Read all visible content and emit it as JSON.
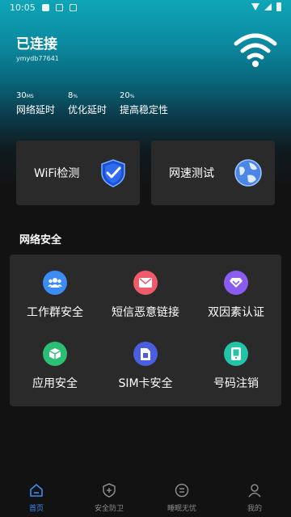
{
  "status_bar": {
    "time": "10:05"
  },
  "connection": {
    "title": "已连接",
    "user": "ymydb77641"
  },
  "stats": [
    {
      "value": "30",
      "unit": "MS",
      "label": "网络延时"
    },
    {
      "value": "8",
      "unit": "%",
      "label": "优化延时"
    },
    {
      "value": "20",
      "unit": "%",
      "label": "提高稳定性"
    }
  ],
  "cards": [
    {
      "label": "WiFi检测",
      "icon": "shield-check-icon"
    },
    {
      "label": "网速测试",
      "icon": "globe-icon"
    }
  ],
  "section": {
    "title": "网络安全"
  },
  "security_items": [
    {
      "label": "工作群安全",
      "icon": "group-icon",
      "color": "#3b8cf5"
    },
    {
      "label": "短信恶意链接",
      "icon": "mail-icon",
      "color": "#ef5b6a"
    },
    {
      "label": "双因素认证",
      "icon": "diamond-icon",
      "color": "#8a5cf0"
    },
    {
      "label": "应用安全",
      "icon": "cube-icon",
      "color": "#2bbf73"
    },
    {
      "label": "SIM卡安全",
      "icon": "sim-icon",
      "color": "#4a5fe0"
    },
    {
      "label": "号码注销",
      "icon": "phone-icon",
      "color": "#22c3a6"
    }
  ],
  "tabs": [
    {
      "label": "首页",
      "icon": "home-icon",
      "active": true
    },
    {
      "label": "安全防卫",
      "icon": "shield-plus-icon",
      "active": false
    },
    {
      "label": "睡眠无忧",
      "icon": "sleep-icon",
      "active": false
    },
    {
      "label": "我的",
      "icon": "user-icon",
      "active": false
    }
  ],
  "colors": {
    "accent": "#3b8cf5",
    "card_bg": "#2a2a2a",
    "page_bg": "#121212"
  }
}
